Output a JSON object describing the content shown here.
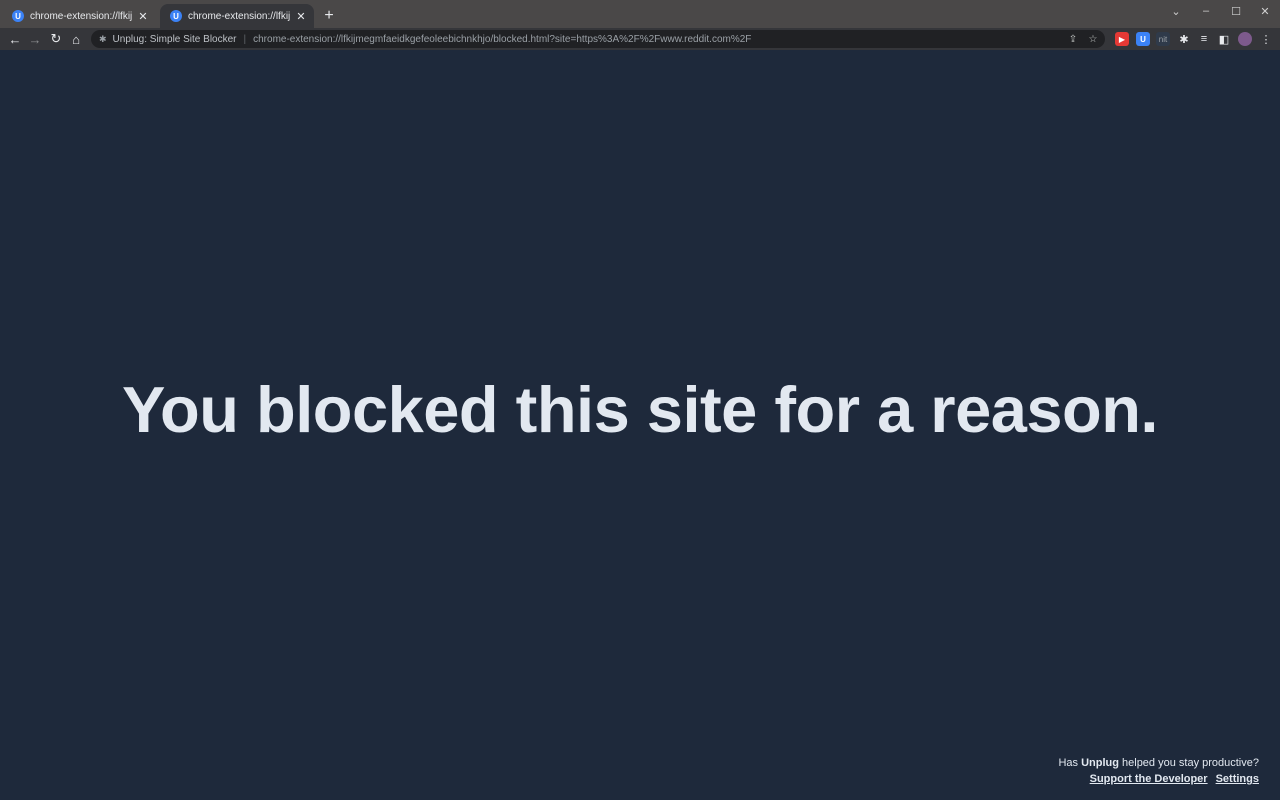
{
  "tabs": [
    {
      "title": "chrome-extension://lfkijmegmfaeidkgefeoleebichnkhjo/blocked.html",
      "favicon": "U",
      "active": false
    },
    {
      "title": "chrome-extension://lfkijmegmfaeidkgefeoleebichnkhjo/blocked.html",
      "favicon": "U",
      "active": true
    }
  ],
  "toolbar": {
    "extension_name": "Unplug: Simple Site Blocker",
    "url": "chrome-extension://lfkijmegmfaeidkgefeoleebichnkhjo/blocked.html?site=https%3A%2F%2Fwww.reddit.com%2F",
    "ext_icons": [
      {
        "label": "",
        "color": "#e53935"
      },
      {
        "label": "U",
        "color": "#3b82f6"
      },
      {
        "label": "nit",
        "color": "#2f3a4a"
      }
    ]
  },
  "page": {
    "headline": "You blocked this site for a reason.",
    "footer_prefix": "Has ",
    "footer_brand": "Unplug",
    "footer_suffix": " helped you stay productive?",
    "support_link": "Support the Developer",
    "settings_link": "Settings"
  },
  "colors": {
    "background": "#1e293b",
    "text": "#e2e8f0",
    "tabstrip": "#4a4848",
    "toolbar": "#35363a"
  }
}
